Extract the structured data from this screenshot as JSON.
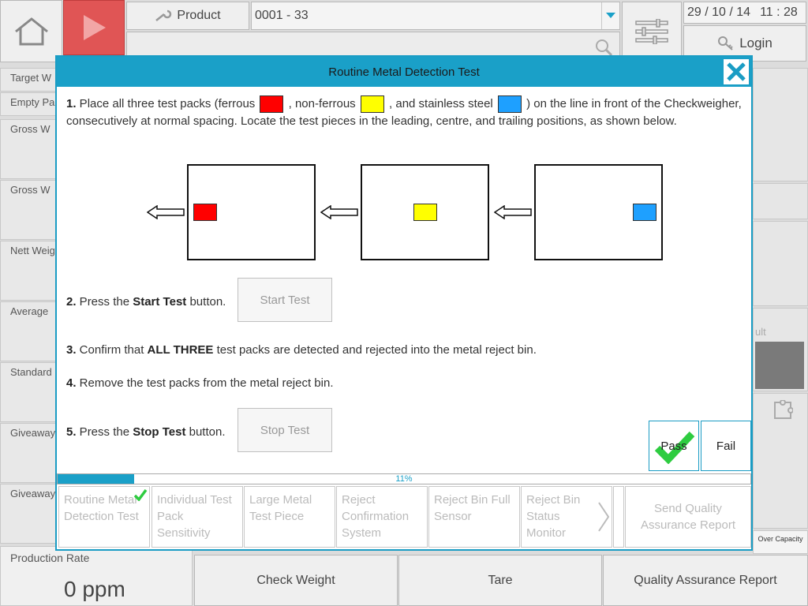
{
  "topbar": {
    "product_label": "Product",
    "product_value": "0001 - 33",
    "date": "29 / 10 / 14",
    "time": "11 : 28",
    "login_label": "Login"
  },
  "left_panel": {
    "labels": [
      "Target W",
      "Empty Pa",
      "Gross W",
      "Gross W",
      "Nett Weig",
      "Average",
      "Standard",
      "Giveaway",
      "Giveaway"
    ]
  },
  "right_panel": {
    "partial_text": "ult",
    "over_capacity": "Over Capacity"
  },
  "production_rate": {
    "label": "Production Rate",
    "value": "0 ppm"
  },
  "bottom_buttons": {
    "check_weight": "Check Weight",
    "tare": "Tare",
    "qa_report": "Quality Assurance Report"
  },
  "dialog": {
    "title": "Routine Metal Detection Test",
    "step1": {
      "num": "1.",
      "text_a": " Place all three test packs (ferrous ",
      "text_b": " , non-ferrous ",
      "text_c": " , and stainless steel ",
      "text_d": " ) on the line in front of the Checkweigher, consecutively at normal spacing. Locate the test pieces in the leading, centre, and trailing positions, as shown below."
    },
    "step2": {
      "num": "2.",
      "text_a": " Press the ",
      "bold": "Start Test",
      "text_b": " button.",
      "button": "Start Test"
    },
    "step3": {
      "num": "3.",
      "text_a": " Confirm that ",
      "bold": "ALL THREE",
      "text_b": " test packs are detected and rejected into the metal reject bin."
    },
    "step4": {
      "num": "4.",
      "text": " Remove the test packs from the metal reject bin."
    },
    "step5": {
      "num": "5.",
      "text_a": " Press the ",
      "bold": "Stop Test",
      "text_b": " button.",
      "button": "Stop Test"
    },
    "pass_label": "Pass",
    "fail_label": "Fail",
    "progress": {
      "value": 0.11,
      "label": "11%"
    },
    "tests": [
      {
        "label": "Routine Metal Detection Test",
        "state": "active"
      },
      {
        "label": "Individual Test Pack Sensitivity",
        "state": "enabled"
      },
      {
        "label": "Large Metal Test Piece",
        "state": "disabled"
      },
      {
        "label": "Reject Confirmation System",
        "state": "disabled"
      },
      {
        "label": "Reject Bin Full Sensor",
        "state": "disabled"
      },
      {
        "label": "Reject Bin Status Monitor",
        "state": "disabled"
      },
      {
        "label": "Send Quality Assurance Report",
        "state": "disabled"
      }
    ]
  },
  "colors": {
    "ferrous": "#ff0000",
    "non_ferrous": "#ffff00",
    "stainless": "#1ea0ff",
    "accent": "#1aa0c8",
    "play": "#e05555",
    "check": "#2ecc40"
  }
}
